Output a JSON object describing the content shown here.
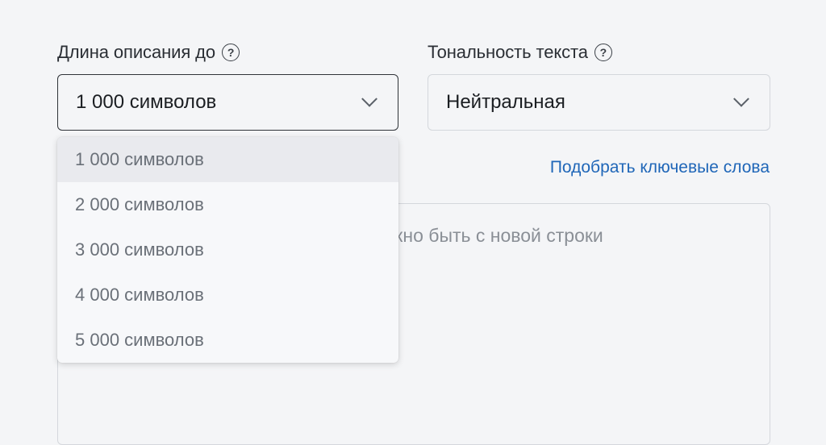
{
  "length": {
    "label": "Длина описания до",
    "help_icon": "question-circle-icon",
    "selected": "1 000 символов",
    "options": [
      "1 000 символов",
      "2 000 символов",
      "3 000 символов",
      "4 000 символов",
      "5 000 символов"
    ]
  },
  "tone": {
    "label": "Тональность текста",
    "help_icon": "question-circle-icon",
    "selected": "Нейтральная"
  },
  "keywords": {
    "link_text": "Подобрать ключевые слова",
    "placeholder_visible": "жно быть с новой строки"
  },
  "colors": {
    "link": "#1f66b8",
    "background": "#f4f5f7"
  }
}
